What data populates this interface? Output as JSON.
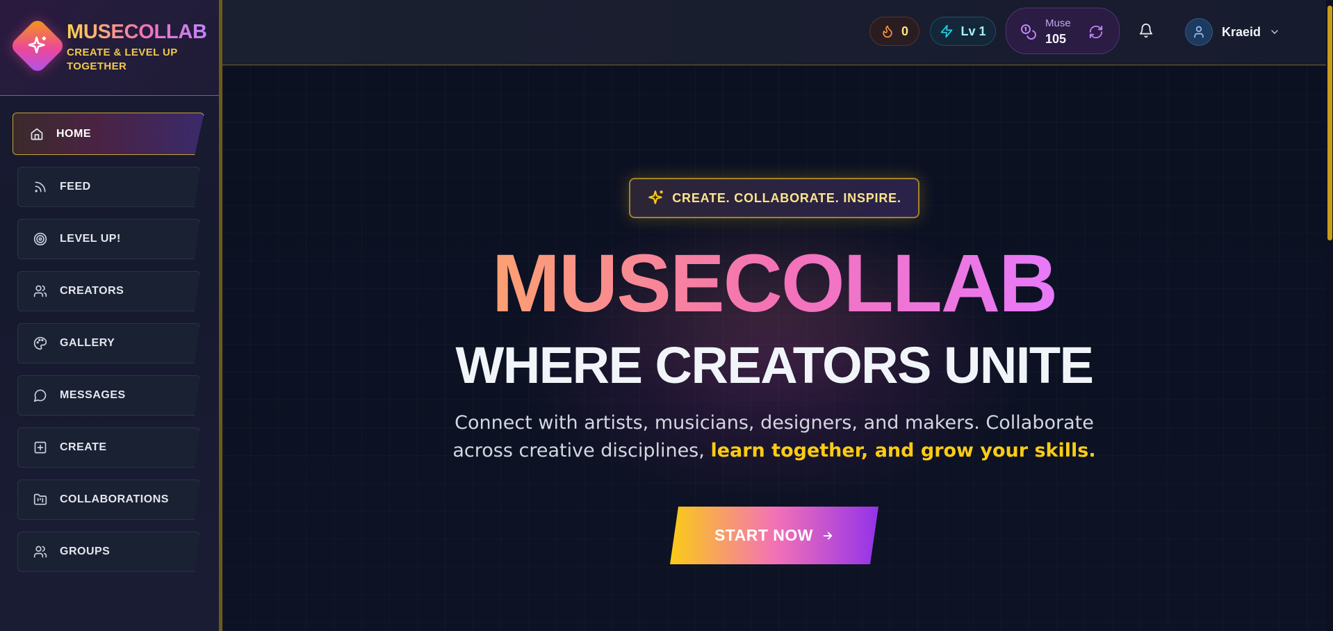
{
  "brand": {
    "name": "MUSECOLLAB",
    "tagline": "CREATE & LEVEL UP TOGETHER"
  },
  "sidebar": {
    "items": [
      {
        "label": "HOME",
        "icon": "home-icon",
        "active": true
      },
      {
        "label": "FEED",
        "icon": "rss-icon"
      },
      {
        "label": "LEVEL UP!",
        "icon": "target-icon"
      },
      {
        "label": "CREATORS",
        "icon": "users-icon"
      },
      {
        "label": "GALLERY",
        "icon": "palette-icon"
      },
      {
        "label": "MESSAGES",
        "icon": "message-circle-icon"
      },
      {
        "label": "CREATE",
        "icon": "plus-square-icon"
      },
      {
        "label": "COLLABORATIONS",
        "icon": "folder-kanban-icon"
      },
      {
        "label": "GROUPS",
        "icon": "group-icon"
      }
    ]
  },
  "header": {
    "streak_count": "0",
    "level_label": "Lv 1",
    "muse_label": "Muse",
    "muse_value": "105",
    "user_name": "Kraeid"
  },
  "hero": {
    "badge": "CREATE. COLLABORATE. INSPIRE.",
    "title": "MUSECOLLAB",
    "subtitle": "WHERE CREATORS UNITE",
    "description": "Connect with artists, musicians, designers, and makers. Collaborate across creative disciplines,",
    "description_highlight": "learn together, and grow your skills.",
    "cta_label": "START NOW"
  },
  "colors": {
    "accent_gold": "#facc15",
    "accent_pink": "#f472b6",
    "accent_purple": "#c084fc",
    "background": "#0b0f1f"
  }
}
